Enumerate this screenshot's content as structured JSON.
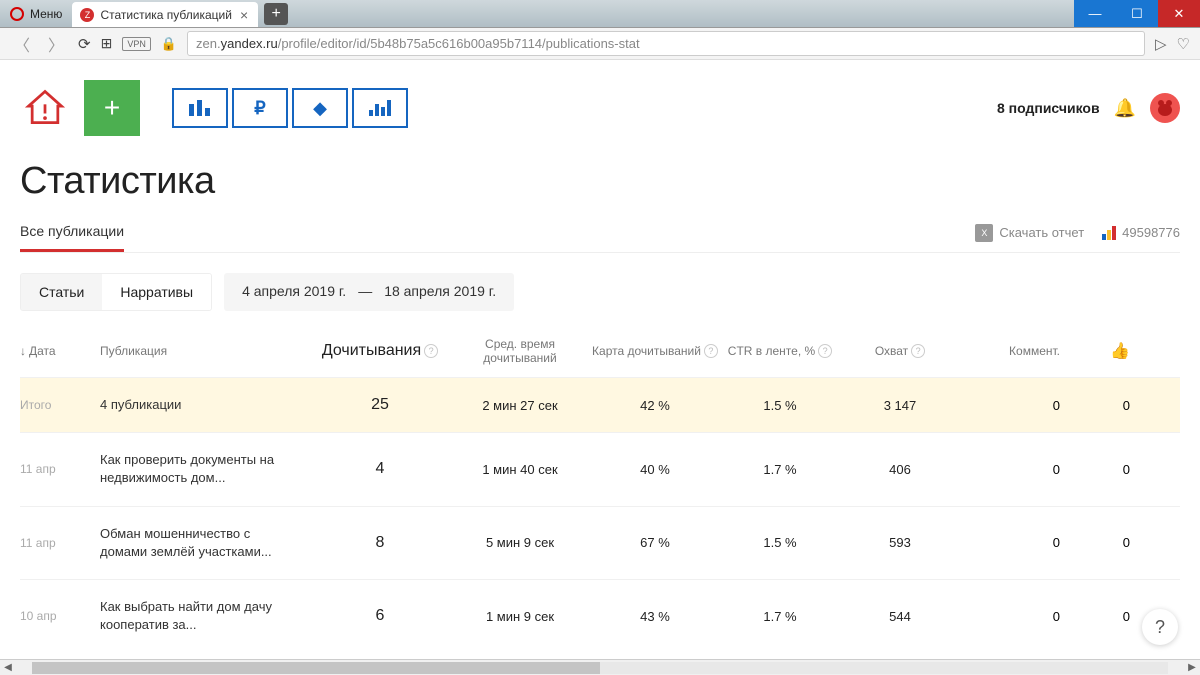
{
  "browser": {
    "menu_label": "Меню",
    "tab_title": "Статистика публикаций",
    "url_prefix": "zen.",
    "url_host": "yandex.ru",
    "url_path": "/profile/editor/id/5b48b75a5c616b00a95b7114/publications-stat",
    "vpn": "VPN"
  },
  "header": {
    "subscribers": "8 подписчиков"
  },
  "page": {
    "title": "Статистика",
    "main_tab": "Все публикации",
    "download": "Скачать отчет",
    "counter_id": "49598776"
  },
  "filters": {
    "articles": "Статьи",
    "narratives": "Нарративы",
    "date_from": "4 апреля 2019 г.",
    "date_sep": "—",
    "date_to": "18 апреля 2019 г."
  },
  "columns": {
    "date": "Дата",
    "publication": "Публикация",
    "reads": "Дочитывания",
    "avg_time": "Сред. время дочитываний",
    "read_map": "Карта дочитываний",
    "ctr": "CTR в ленте, %",
    "reach": "Охват",
    "comments": "Коммент."
  },
  "total": {
    "label": "Итого",
    "pub": "4 публикации",
    "reads": "25",
    "avg_time": "2 мин 27 сек",
    "read_pct": "42 %",
    "ctr": "1.5 %",
    "reach": "3 147",
    "comments": "0",
    "likes": "0"
  },
  "rows": [
    {
      "date": "11 апр",
      "pub": "Как проверить документы на недвижимость дом...",
      "reads": "4",
      "avg_time": "1 мин 40 сек",
      "read_pct": "40 %",
      "ctr": "1.7 %",
      "reach": "406",
      "comments": "0",
      "likes": "0"
    },
    {
      "date": "11 апр",
      "pub": "Обман мошенничество с домами землёй участками...",
      "reads": "8",
      "avg_time": "5 мин 9 сек",
      "read_pct": "67 %",
      "ctr": "1.5 %",
      "reach": "593",
      "comments": "0",
      "likes": "0"
    },
    {
      "date": "10 апр",
      "pub": "Как выбрать найти дом дачу кооператив за...",
      "reads": "6",
      "avg_time": "1 мин 9 сек",
      "read_pct": "43 %",
      "ctr": "1.7 %",
      "reach": "544",
      "comments": "0",
      "likes": "0"
    }
  ]
}
